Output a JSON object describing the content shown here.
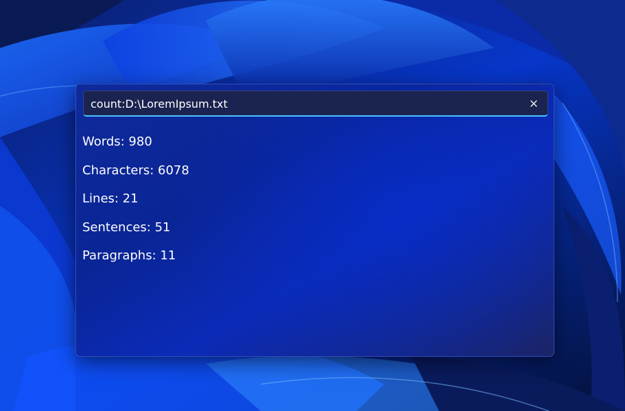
{
  "search": {
    "value": "count:D:\\LoremIpsum.txt",
    "clear_icon": "close-icon"
  },
  "results": [
    {
      "label": "Words: 980"
    },
    {
      "label": "Characters: 6078"
    },
    {
      "label": "Lines: 21"
    },
    {
      "label": "Sentences: 51"
    },
    {
      "label": "Paragraphs: 11"
    }
  ],
  "colors": {
    "accent": "#4cc2ff",
    "panel": "#0a2596",
    "text": "#ffffff"
  }
}
